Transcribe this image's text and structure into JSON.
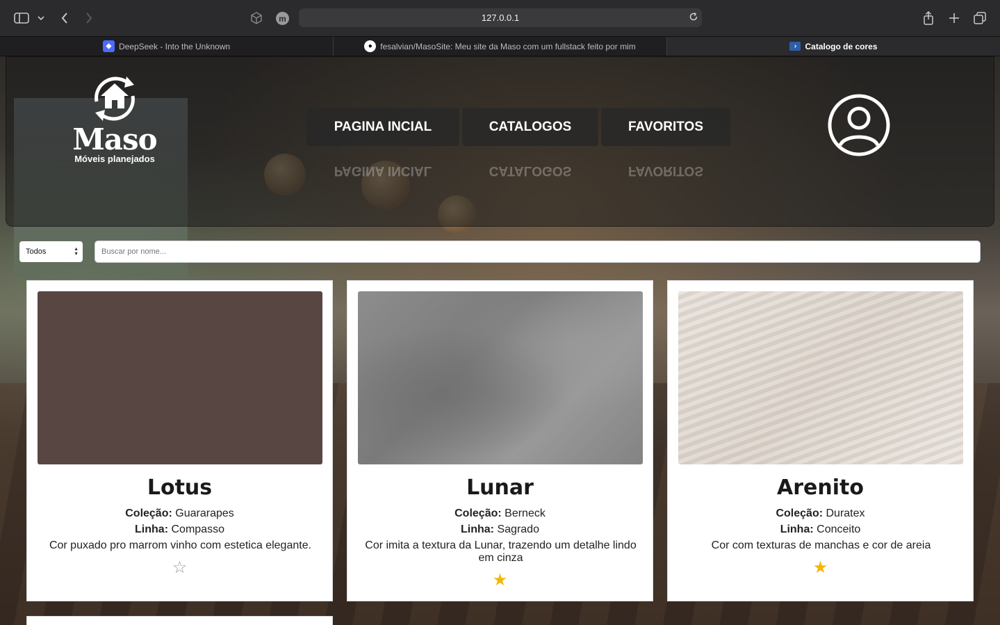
{
  "browser": {
    "url": "127.0.0.1",
    "profile_initial": "m",
    "tabs": [
      {
        "title": "DeepSeek - Into the Unknown"
      },
      {
        "title": "fesalvian/MasoSite: Meu site da Maso com um fullstack feito por mim"
      },
      {
        "title": "Catalogo de cores"
      }
    ]
  },
  "header": {
    "logo_word": "Maso",
    "logo_sub": "Móveis planejados",
    "nav": [
      "PAGINA INCIAL",
      "CATALOGOS",
      "FAVORITOS"
    ]
  },
  "filters": {
    "select_value": "Todos",
    "search_placeholder": "Buscar por nome..."
  },
  "labels": {
    "colecao": "Coleção:",
    "linha": "Linha:"
  },
  "cards": [
    {
      "name": "Lotus",
      "colecao": "Guararapes",
      "linha": "Compasso",
      "descricao": "Cor puxado pro marrom vinho com estetica elegante.",
      "favorito": false,
      "star": "☆"
    },
    {
      "name": "Lunar",
      "colecao": "Berneck",
      "linha": "Sagrado",
      "descricao": "Cor imita a textura da Lunar, trazendo um detalhe lindo em cinza",
      "favorito": true,
      "star": "★"
    },
    {
      "name": "Arenito",
      "colecao": "Duratex",
      "linha": "Conceito",
      "descricao": "Cor com texturas de manchas e cor de areia",
      "favorito": true,
      "star": "★"
    }
  ],
  "colors": {
    "lotus_swatch": "#574642",
    "star_active": "#f2b705",
    "star_inactive": "#9a9a9a"
  }
}
